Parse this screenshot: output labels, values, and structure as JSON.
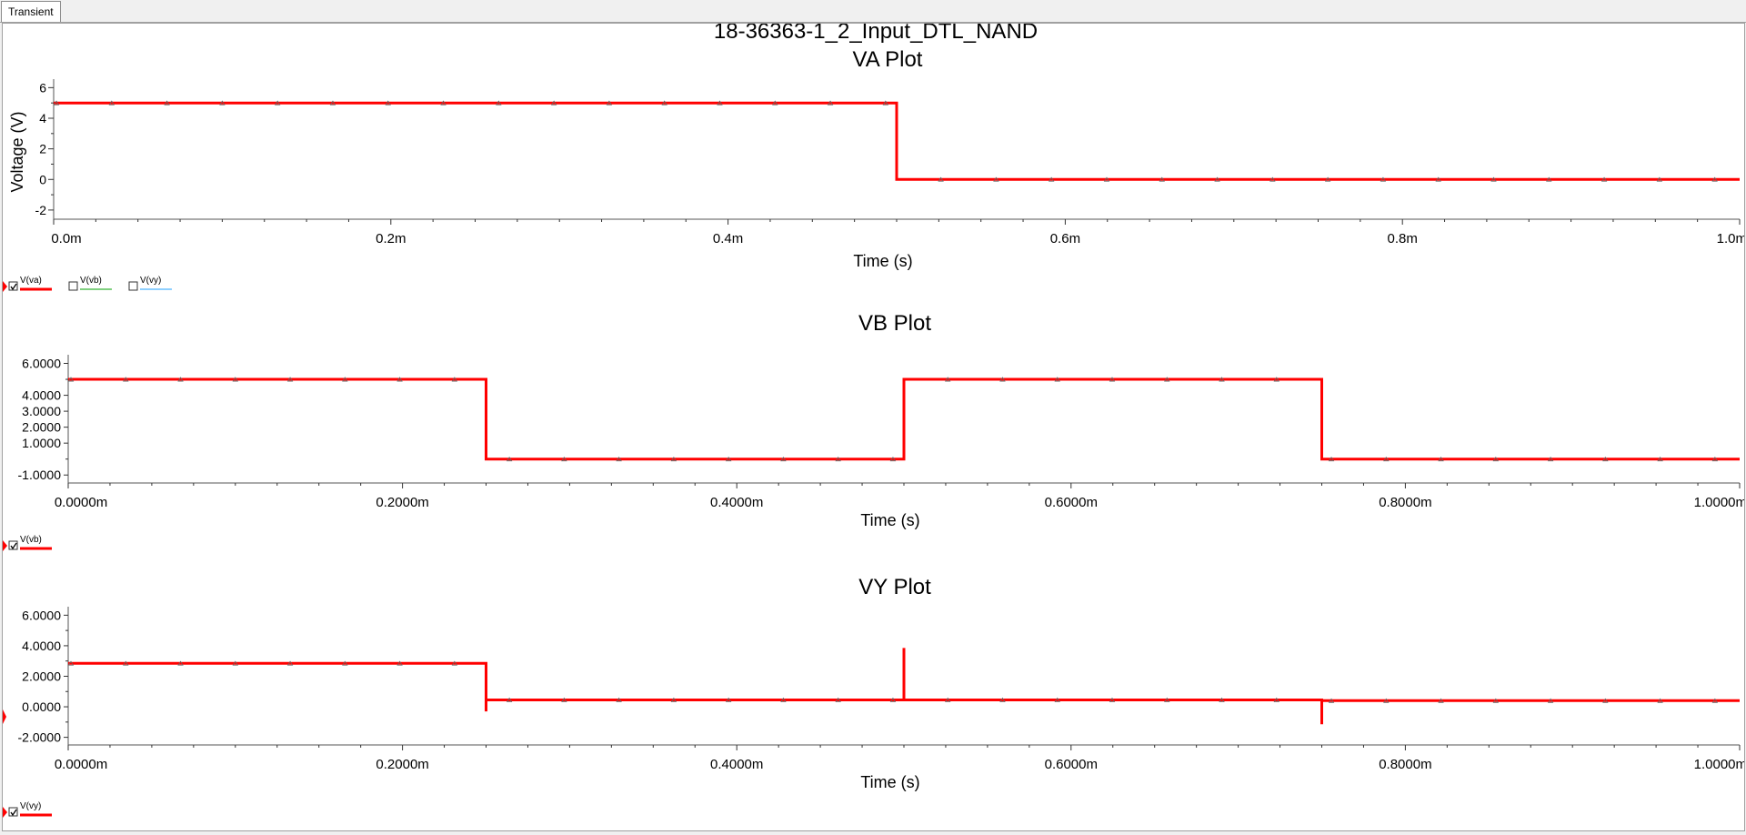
{
  "tabs": [
    {
      "label": "Transient",
      "active": true
    }
  ],
  "page_title": "18-36363-1_2_Input_DTL_NAND",
  "trace_color": "#ff0000",
  "legend_colors": {
    "va": "#ff0000",
    "vb": "#00a000",
    "vy": "#1fa0ff"
  },
  "chart_data": [
    {
      "type": "line",
      "title": "VA Plot",
      "xlabel": "Time (s)",
      "ylabel": "Voltage (V)",
      "xlim": [
        0,
        0.001
      ],
      "ylim": [
        -2.6,
        6.2
      ],
      "yticks": [
        -2,
        0,
        2,
        4,
        6
      ],
      "ytick_labels": [
        "-2",
        "0",
        "2",
        "4",
        "6"
      ],
      "xticks": [
        0,
        0.0002,
        0.0004,
        0.0006,
        0.0008,
        0.001
      ],
      "xtick_labels": [
        "0.0m",
        "0.2m",
        "0.4m",
        "0.6m",
        "0.8m",
        "1.0m"
      ],
      "legend": [
        {
          "label": "V(va)",
          "checked": true
        },
        {
          "label": "V(vb)",
          "checked": false
        },
        {
          "label": "V(vy)",
          "checked": false
        }
      ],
      "series": [
        {
          "x": [
            0,
            0.0005,
            0.0005,
            0.001
          ],
          "y": [
            5,
            5,
            0,
            0
          ]
        }
      ]
    },
    {
      "type": "line",
      "title": "VB Plot",
      "xlabel": "Time (s)",
      "ylabel": "",
      "xlim": [
        0,
        0.001
      ],
      "ylim": [
        -1.5,
        6.2
      ],
      "yticks": [
        -1,
        1,
        2,
        3,
        4,
        6
      ],
      "ytick_labels": [
        "-1.0000",
        "1.0000",
        "2.0000",
        "3.0000",
        "4.0000",
        "6.0000"
      ],
      "xticks": [
        0,
        0.0002,
        0.0004,
        0.0006,
        0.0008,
        0.001
      ],
      "xtick_labels": [
        "0.0000m",
        "0.2000m",
        "0.4000m",
        "0.6000m",
        "0.8000m",
        "1.0000m"
      ],
      "legend": [
        {
          "label": "V(vb)",
          "checked": true
        }
      ],
      "series": [
        {
          "x": [
            0,
            0.00025,
            0.00025,
            0.0005,
            0.0005,
            0.00075,
            0.00075,
            0.001
          ],
          "y": [
            5,
            5,
            0,
            0,
            5,
            5,
            0,
            0
          ]
        }
      ]
    },
    {
      "type": "line",
      "title": "VY Plot",
      "xlabel": "Time (s)",
      "ylabel": "",
      "xlim": [
        0,
        0.001
      ],
      "ylim": [
        -2.5,
        6.2
      ],
      "yticks": [
        -2,
        0,
        2,
        4,
        6
      ],
      "ytick_labels": [
        "-2.0000",
        "0.0000",
        "2.0000",
        "4.0000",
        "6.0000"
      ],
      "xticks": [
        0,
        0.0002,
        0.0004,
        0.0006,
        0.0008,
        0.001
      ],
      "xtick_labels": [
        "0.0000m",
        "0.2000m",
        "0.4000m",
        "0.6000m",
        "0.8000m",
        "1.0000m"
      ],
      "legend": [
        {
          "label": "V(vy)",
          "checked": true
        }
      ],
      "series": [
        {
          "x": [
            0,
            0.00025,
            0.00025,
            0.00025,
            0.0005,
            0.0005,
            0.0005,
            0.00075,
            0.00075,
            0.00075,
            0.001
          ],
          "y": [
            2.85,
            2.85,
            -0.3,
            0.45,
            0.45,
            3.85,
            0.45,
            0.45,
            -1.15,
            0.4,
            0.4
          ]
        }
      ]
    }
  ]
}
